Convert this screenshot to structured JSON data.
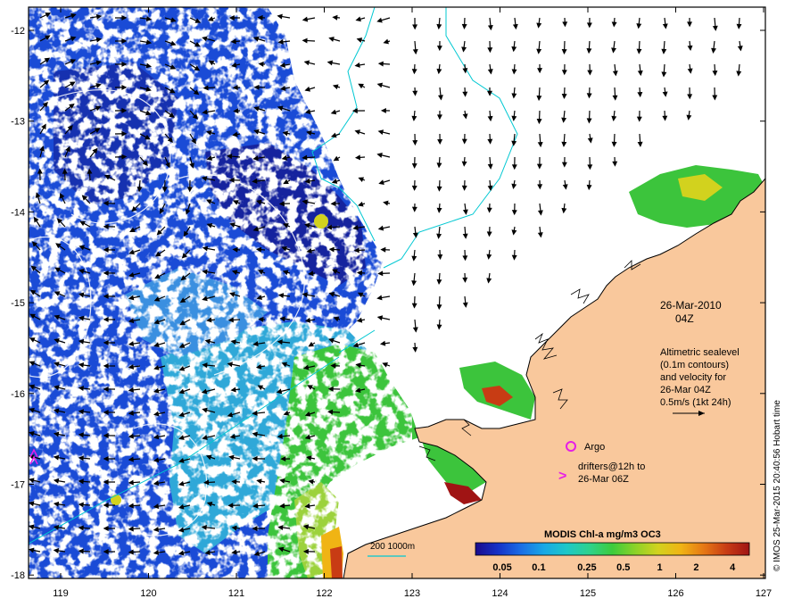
{
  "axes": {
    "x_ticks": [
      "119",
      "120",
      "121",
      "122",
      "123",
      "124",
      "125",
      "126",
      "127"
    ],
    "y_ticks": [
      "-12",
      "-13",
      "-14",
      "-15",
      "-16",
      "-17",
      "-18"
    ]
  },
  "annotation": {
    "date": "26-Mar-2010",
    "time": "04Z",
    "alt_lines": [
      "Altimetric sealevel",
      "(0.1m contours)",
      "and velocity for",
      "26-Mar 04Z",
      "0.5m/s (1kt 24h)"
    ]
  },
  "legend": {
    "argo_label": "Argo",
    "drifters_line1": "drifters@12h to",
    "drifters_line2": "26-Mar 06Z",
    "bathy_label": "200  1000m"
  },
  "colorbar": {
    "title": "MODIS Chl-a mg/m3 OC3",
    "tick_labels": [
      "0.05",
      "0.1",
      "0.25",
      "0.5",
      "1",
      "2",
      "4"
    ],
    "colors": [
      "#1a0a8c",
      "#1532c8",
      "#1a6ee6",
      "#19a8e6",
      "#1ec8c8",
      "#2ed28c",
      "#3ccc3c",
      "#8cd228",
      "#d2d21e",
      "#f0b414",
      "#e67814",
      "#c83c14",
      "#a01414"
    ]
  },
  "credit": "© IMOS 25-Mar-2015 20:40:56 Hobart time",
  "colors": {
    "land": "#f9c89c",
    "ocean_low": "#1a4bd6",
    "ocean_mid": "#2fa8d8",
    "ocean_high": "#3cc43c",
    "contour": "#00c8d2",
    "argo": "#e61ee6"
  }
}
